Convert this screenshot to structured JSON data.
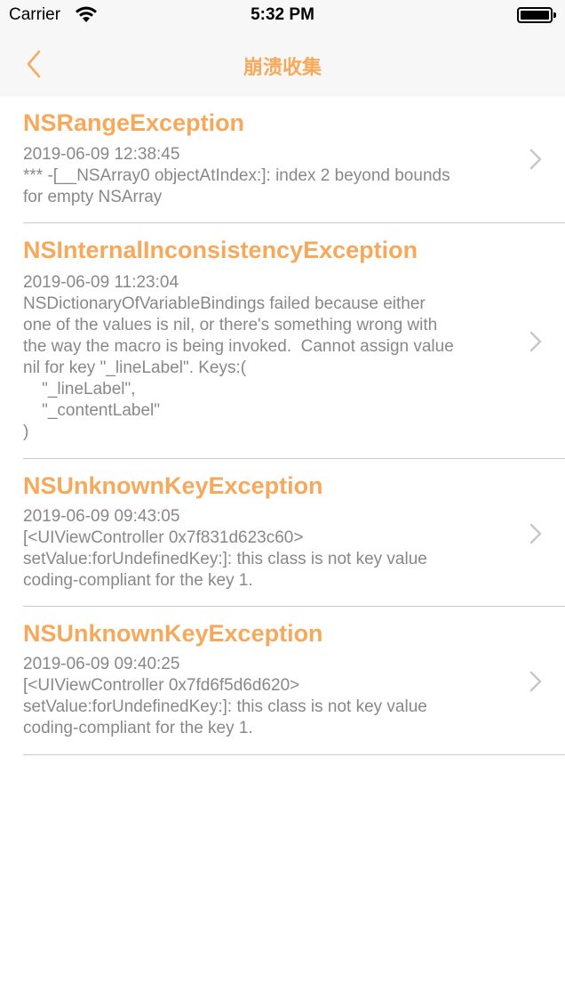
{
  "status_bar": {
    "carrier": "Carrier",
    "time": "5:32 PM"
  },
  "nav": {
    "title": "崩溃收集",
    "back_icon": "chevron-left-icon"
  },
  "colors": {
    "accent": "#f7a95b",
    "secondary_text": "#888888",
    "nav_background": "#f7f7f7"
  },
  "crashes": [
    {
      "name": "NSRangeException",
      "time": "2019-06-09 12:38:45",
      "message": "*** -[__NSArray0 objectAtIndex:]: index 2 beyond bounds\nfor empty NSArray"
    },
    {
      "name": "NSInternalInconsistencyException",
      "time": "2019-06-09 11:23:04",
      "message": "NSDictionaryOfVariableBindings failed because either\none of the values is nil, or there's something wrong with\nthe way the macro is being invoked.  Cannot assign value\nnil for key \"_lineLabel\". Keys:(\n    \"_lineLabel\",\n    \"_contentLabel\"\n)"
    },
    {
      "name": "NSUnknownKeyException",
      "time": "2019-06-09 09:43:05",
      "message": "[<UIViewController 0x7f831d623c60>\nsetValue:forUndefinedKey:]: this class is not key value\ncoding-compliant for the key 1."
    },
    {
      "name": "NSUnknownKeyException",
      "time": "2019-06-09 09:40:25",
      "message": "[<UIViewController 0x7fd6f5d6d620>\nsetValue:forUndefinedKey:]: this class is not key value\ncoding-compliant for the key 1."
    }
  ]
}
